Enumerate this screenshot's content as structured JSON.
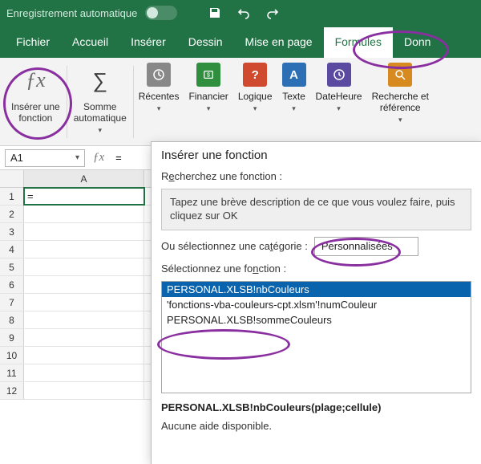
{
  "titlebar": {
    "autosave": "Enregistrement automatique"
  },
  "tabs": {
    "file": "Fichier",
    "home": "Accueil",
    "insert": "Insérer",
    "draw": "Dessin",
    "layout": "Mise en page",
    "formulas": "Formules",
    "data": "Donn"
  },
  "ribbon": {
    "insert_fn": "Insérer une\nfonction",
    "autosum": "Somme\nautomatique",
    "recent": "Récentes",
    "financial": "Financier",
    "logical": "Logique",
    "text": "Texte",
    "datetime": "DateHeure",
    "lookup": "Recherche et\nréférence"
  },
  "namebox": "A1",
  "formula": "=",
  "columns": [
    "A"
  ],
  "rows": [
    "1",
    "2",
    "3",
    "4",
    "5",
    "6",
    "7",
    "8",
    "9",
    "10",
    "11",
    "12"
  ],
  "cell_a1": "=",
  "dialog": {
    "title": "Insérer une fonction",
    "search_label_pre": "R",
    "search_label_u": "e",
    "search_label_post": "cherchez une fonction :",
    "search_placeholder": "Tapez une brève description de ce que vous voulez faire, puis cliquez sur OK",
    "category_label_pre": "Ou sélectionnez une ca",
    "category_label_u": "t",
    "category_label_post": "égorie :",
    "category_value": "Personnalisées",
    "select_label_pre": "Sélectionnez une fo",
    "select_label_u": "n",
    "select_label_post": "ction :",
    "functions": [
      "PERSONAL.XLSB!nbCouleurs",
      "'fonctions-vba-couleurs-cpt.xlsm'!numCouleur",
      "PERSONAL.XLSB!sommeCouleurs"
    ],
    "syntax": "PERSONAL.XLSB!nbCouleurs(plage;cellule)",
    "help": "Aucune aide disponible."
  }
}
